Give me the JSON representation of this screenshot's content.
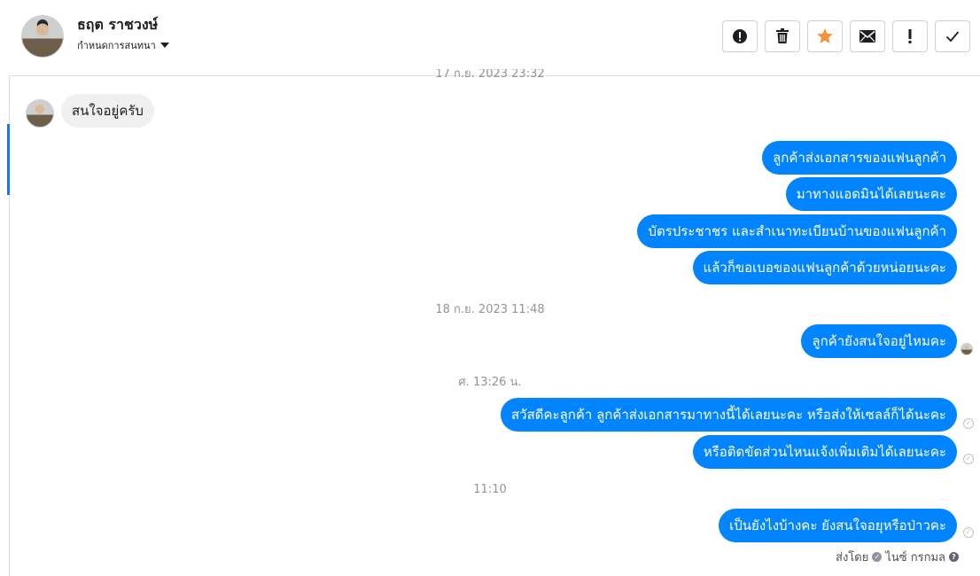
{
  "contact": {
    "name": "ธฤต ราชวงษ์",
    "settings_label": "กำหนดการสนทนา"
  },
  "toolbar": {
    "buttons": [
      {
        "name": "spam",
        "glyph": "!",
        "icon": "exclamation-circle-icon"
      },
      {
        "name": "delete",
        "glyph": "🗑",
        "icon": "trash-icon"
      },
      {
        "name": "star",
        "glyph": "★",
        "icon": "star-icon",
        "color": "#f7923a"
      },
      {
        "name": "mark-unread",
        "glyph": "✉",
        "icon": "envelope-icon"
      },
      {
        "name": "follow-up",
        "glyph": "!",
        "icon": "exclamation-icon"
      },
      {
        "name": "done",
        "glyph": "✓",
        "icon": "check-icon"
      }
    ]
  },
  "timestamps": {
    "clipped": "17 ก.ย. 2023 23:32",
    "t1": "18 ก.ย. 2023 11:48",
    "t2": "ศ. 13:26 น.",
    "t3": "11:10"
  },
  "messages": {
    "in1": "สนใจอยู่ครับ",
    "out1": "ลูกค้าส่งเอกสารของแฟนลูกค้า",
    "out2": "มาทางแอดมินได้เลยนะคะ",
    "out3": "บัตรประชาชร และสำเนาทะเบียนบ้านของแฟนลูกค้า",
    "out4": "แล้วก็ขอเบอของแฟนลูกค้าด้วยหน่อยนะคะ",
    "out5": "ลูกค้ายังสนใจอยู่ไหมคะ",
    "out6": "สวัสดีคะลูกค้า ลูกค้าส่งเอกสารมาทางนี้ได้เลยนะคะ หรือส่งให้เซลล์ก็ได้นะคะ",
    "out7": "หรือติดขัดส่วนไหนแจ้งเพิ่มเติมได้เลยนะคะ",
    "out8": "เป็นยังไงบ้างคะ ยังสนใจอยุหรือป่าวคะ"
  },
  "footer": {
    "sent_by_label": "ส่งโดย",
    "sender_name": "ไนซ์ กรกมล"
  },
  "colors": {
    "outgoing_bubble": "#0084ff",
    "incoming_bubble": "#f1f0f0",
    "accent": "#1877f2"
  }
}
